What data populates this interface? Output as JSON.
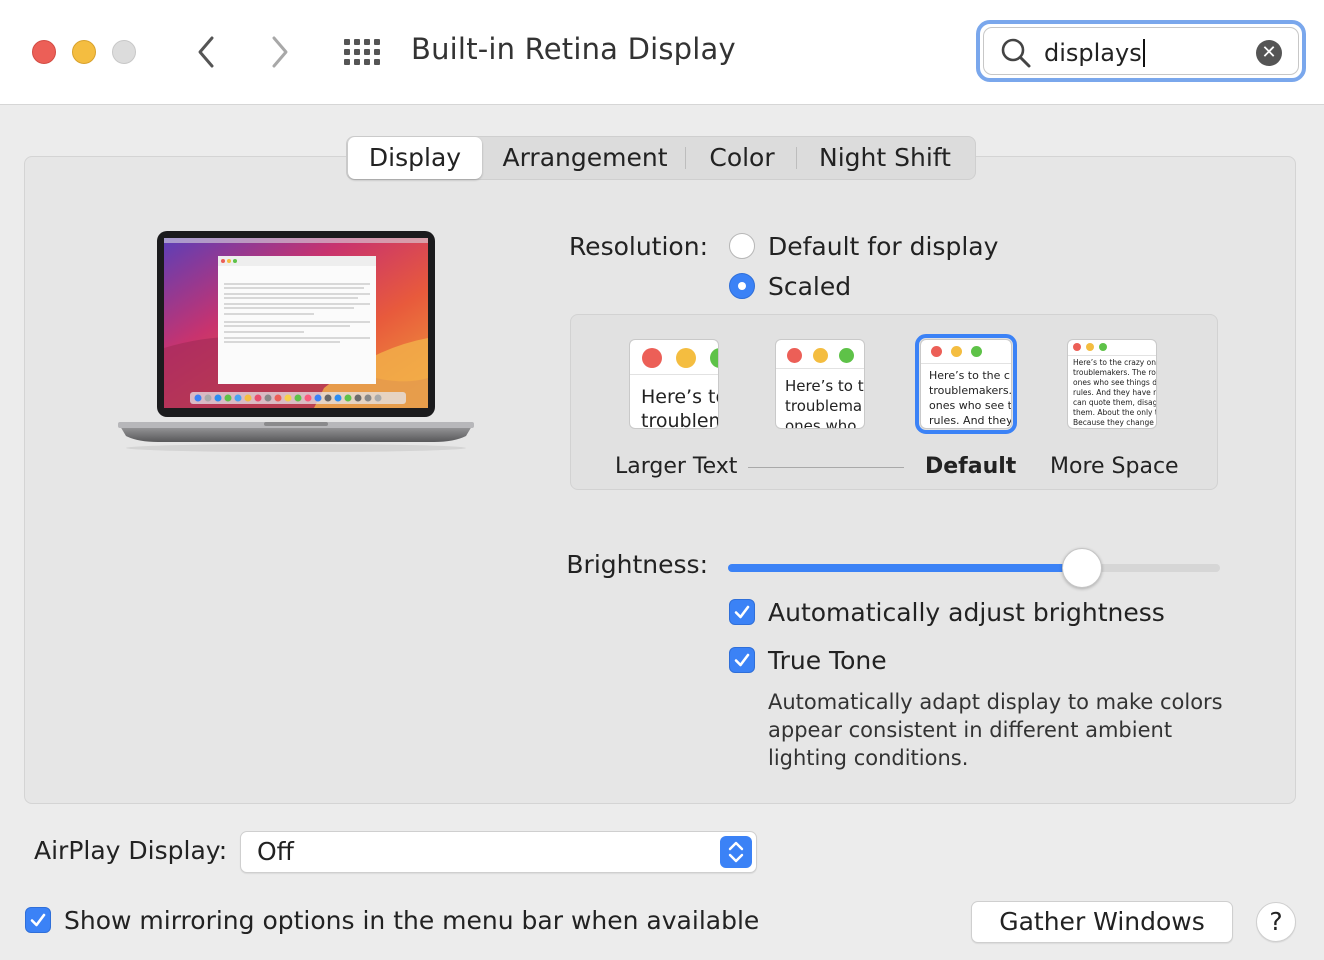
{
  "window": {
    "title": "Built-in Retina Display",
    "controls": [
      "close",
      "minimize",
      "zoom"
    ]
  },
  "toolbar": {
    "back_icon": "chevron-left-icon",
    "forward_icon": "chevron-right-icon",
    "show_all_icon": "grid-icon"
  },
  "search": {
    "value": "displays",
    "clear_icon": "clear-icon"
  },
  "tabs": [
    {
      "label": "Display",
      "selected": true
    },
    {
      "label": "Arrangement",
      "selected": false
    },
    {
      "label": "Color",
      "selected": false
    },
    {
      "label": "Night Shift",
      "selected": false
    }
  ],
  "resolution": {
    "label": "Resolution:",
    "options": [
      {
        "label": "Default for display",
        "selected": false
      },
      {
        "label": "Scaled",
        "selected": true
      }
    ],
    "scale_labels": {
      "larger": "Larger Text",
      "default": "Default",
      "more": "More Space"
    },
    "thumb_texts": {
      "t1": "Here’s to\ntroublem",
      "t2": "Here’s to t\ntroublema\nones who",
      "t3": "Here’s to the cr\ntroublemakers.\nones who see t\nrules. And they",
      "t4": "Here’s to the crazy one\ntroublemakers. The rou\nones who see things dif\nrules. And they have no\ncan quote them, disagr\nthem. About the only th\nBecause they change th"
    },
    "selected_scale_index": 2
  },
  "brightness": {
    "label": "Brightness:",
    "level": 0.72,
    "auto_label": "Automatically adjust brightness",
    "auto_checked": true,
    "true_tone_label": "True Tone",
    "true_tone_checked": true,
    "true_tone_desc": "Automatically adapt display to make colors appear consistent in different ambient lighting conditions."
  },
  "airplay": {
    "label": "AirPlay Display:",
    "value": "Off"
  },
  "mirroring": {
    "label": "Show mirroring options in the menu bar when available",
    "checked": true
  },
  "buttons": {
    "gather": "Gather Windows",
    "help": "?"
  },
  "colors": {
    "accent": "#3b82f6",
    "close": "#ec5f57",
    "minimize": "#f4bd40"
  }
}
